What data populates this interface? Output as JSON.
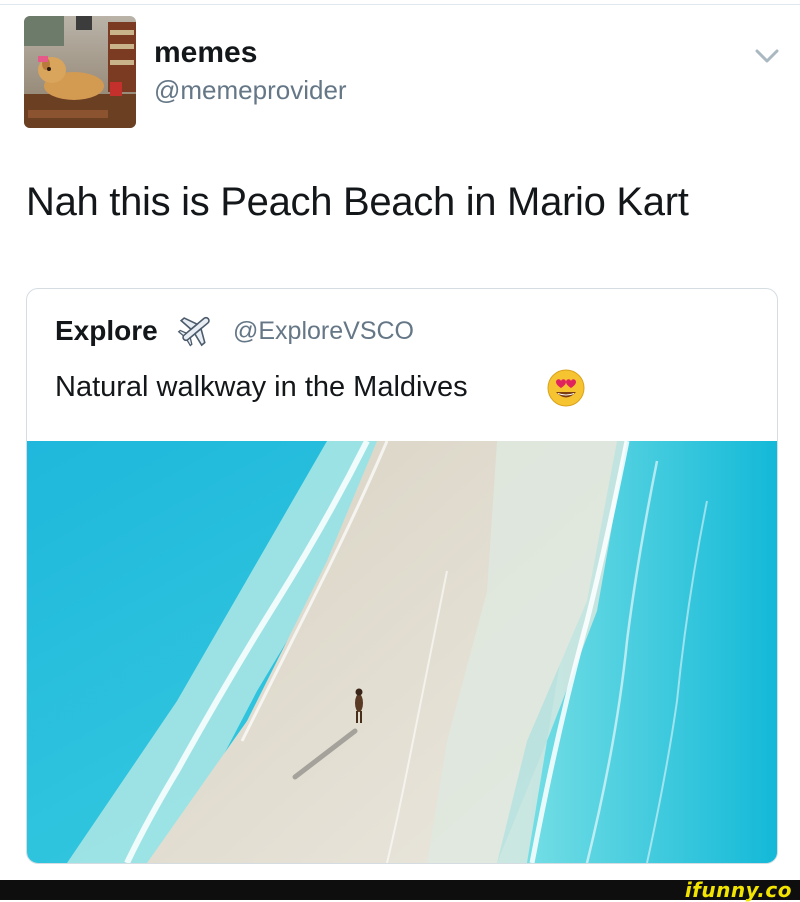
{
  "tweet": {
    "display_name": "memes",
    "handle": "@memeprovider",
    "text": "Nah this is Peach Beach in Mario Kart",
    "menu_icon": "chevron-down-icon"
  },
  "quoted_tweet": {
    "display_name": "Explore",
    "name_icon": "airplane-icon",
    "handle": "@ExploreVSCO",
    "text": "Natural walkway in the Maldives",
    "text_emoji": "heart-eyes-emoji-icon",
    "photo": "aerial beach photo"
  },
  "footer": {
    "watermark": "ifunny.co"
  },
  "colors": {
    "primary_text": "#14171a",
    "secondary_text": "#657786",
    "border": "#d5dde3",
    "watermark": "#f2e400"
  }
}
